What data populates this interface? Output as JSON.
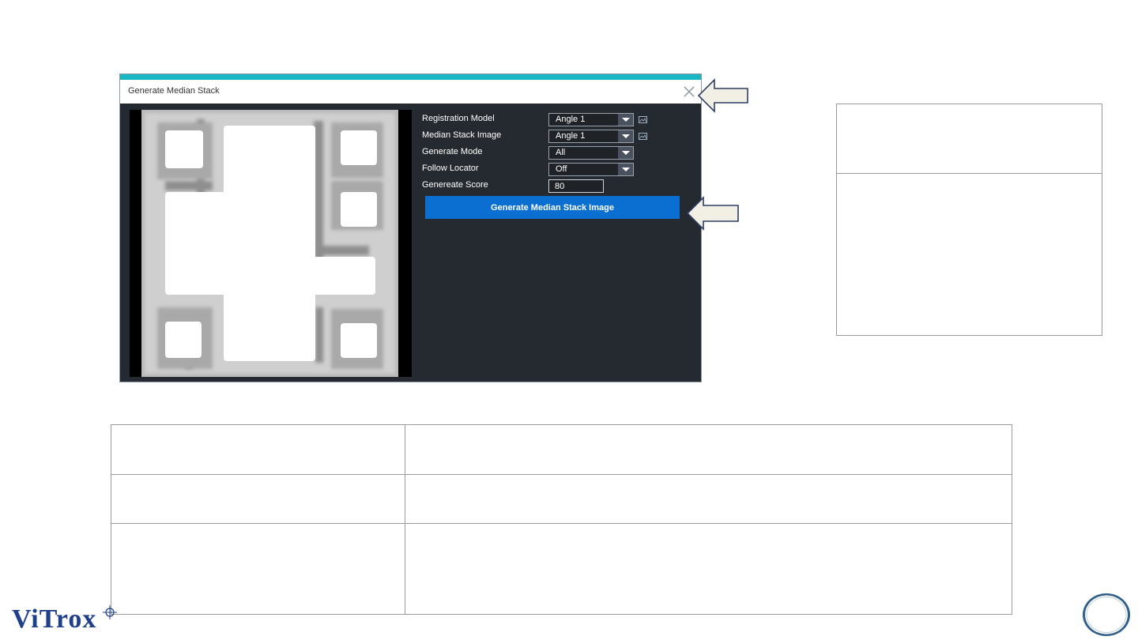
{
  "dialog": {
    "title": "Generate Median Stack",
    "close_label": "×",
    "accent_color": "#19b6c4",
    "body_color": "#252a31",
    "fields": [
      {
        "label": "Registration Model",
        "value": "Angle 1",
        "has_image_icon": true
      },
      {
        "label": "Median Stack Image",
        "value": "Angle 1",
        "has_image_icon": true
      },
      {
        "label": "Generate Mode",
        "value": "All",
        "has_image_icon": false
      },
      {
        "label": "Follow Locator",
        "value": "Off",
        "has_image_icon": false
      }
    ],
    "score": {
      "label": "Genereate Score",
      "value": "80"
    },
    "generate_button": {
      "label": "Generate Median Stack Image",
      "color": "#0a6fd1"
    }
  },
  "callouts": {
    "fill": "#f2efe4",
    "stroke": "#2c3e66"
  },
  "side_panel": {
    "header": "",
    "body": ""
  },
  "table": {
    "rows": [
      [
        "",
        ""
      ],
      [
        "",
        ""
      ],
      [
        "",
        ""
      ]
    ]
  },
  "logo": {
    "text": "ViTrox",
    "color": "#1f3f8a"
  },
  "page_badge": {
    "label": ""
  }
}
